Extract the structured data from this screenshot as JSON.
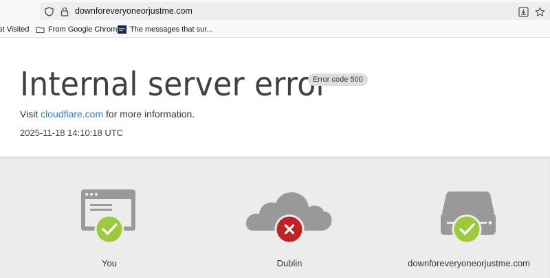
{
  "browser": {
    "url": "downforeveryoneorjustme.com",
    "bookmarks": [
      {
        "label": "ost Visited",
        "icon": "none"
      },
      {
        "label": "From Google Chrome",
        "icon": "folder-icon"
      },
      {
        "label": "The messages that sur...",
        "icon": "site-favicon"
      }
    ]
  },
  "error": {
    "title": "Internal server error",
    "code_badge": "Error code 500",
    "visit_prefix": "Visit ",
    "visit_link": "cloudflare.com",
    "visit_suffix": " for more information.",
    "timestamp": "2025-11-18 14:10:18 UTC"
  },
  "nodes": [
    {
      "label": "You",
      "icon": "browser-window-icon",
      "status": "ok",
      "status_color": "#9bca3e"
    },
    {
      "label": "Dublin",
      "icon": "cloud-icon",
      "status": "error",
      "status_color": "#bd2426"
    },
    {
      "label": "downforeveryoneorjustme.com",
      "icon": "server-icon",
      "status": "ok",
      "status_color": "#9bca3e"
    }
  ],
  "colors": {
    "icon_gray": "#999999",
    "ok_green": "#9bca3e",
    "error_red": "#bd2426",
    "link_blue": "#2f7bbf"
  }
}
